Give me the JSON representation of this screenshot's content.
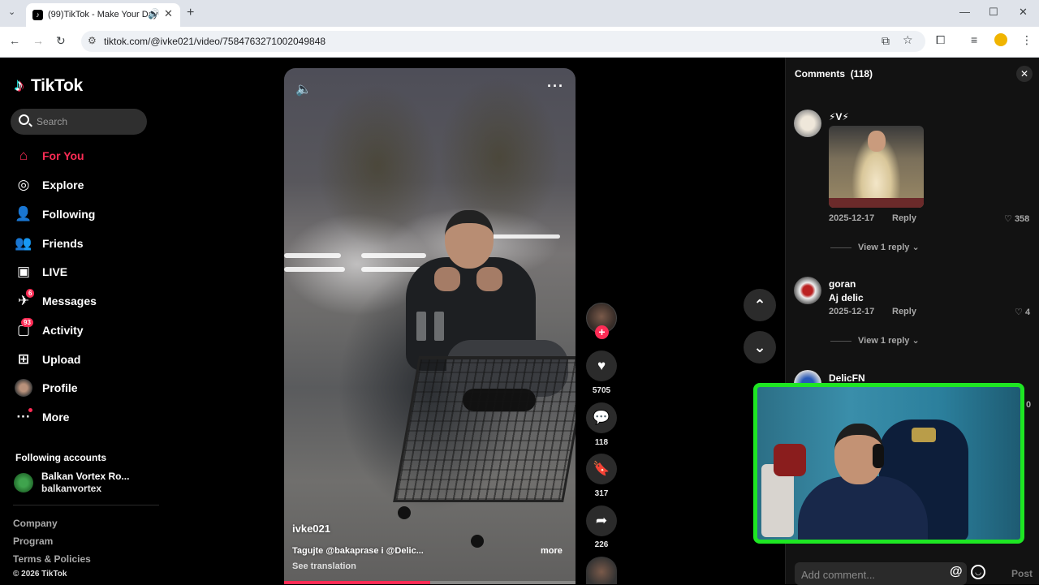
{
  "browser": {
    "tab_title": "(99)TikTok - Make Your Day",
    "url": "tiktok.com/@ivke021/video/7584763271002049848"
  },
  "sidebar": {
    "logo": "TikTok",
    "search_placeholder": "Search",
    "nav": [
      {
        "label": "For You",
        "icon": "home-icon",
        "active": true
      },
      {
        "label": "Explore",
        "icon": "compass-icon"
      },
      {
        "label": "Following",
        "icon": "following-icon"
      },
      {
        "label": "Friends",
        "icon": "friends-icon"
      },
      {
        "label": "LIVE",
        "icon": "live-icon"
      },
      {
        "label": "Messages",
        "icon": "messages-icon",
        "badge": "6"
      },
      {
        "label": "Activity",
        "icon": "activity-icon",
        "badge": "93"
      },
      {
        "label": "Upload",
        "icon": "upload-icon"
      },
      {
        "label": "Profile",
        "icon": "profile-avatar"
      },
      {
        "label": "More",
        "icon": "more-icon"
      }
    ],
    "following_accounts_title": "Following accounts",
    "following": [
      {
        "name": "Balkan Vortex Ro...",
        "handle": "balkanvortex"
      }
    ],
    "footer": [
      "Company",
      "Program",
      "Terms & Policies",
      "© 2026 TikTok"
    ]
  },
  "video": {
    "author": "ivke021",
    "description": "Tagujte @bakaprase i @Delic...",
    "more": "more",
    "see_translation": "See translation",
    "progress": 0.5
  },
  "actions": {
    "likes": "5705",
    "comments": "118",
    "saves": "317",
    "shares": "226"
  },
  "comments": {
    "title": "Comments",
    "count": "(118)",
    "items": [
      {
        "name": "⚡V⚡",
        "text": "",
        "date": "2025-12-17",
        "reply": "Reply",
        "likes": "358",
        "view_replies": "View 1 reply"
      },
      {
        "name": "goran",
        "text": "Aj delic",
        "date": "2025-12-17",
        "reply": "Reply",
        "likes": "4",
        "view_replies": "View 1 reply"
      },
      {
        "name": "DelicFN",
        "likes": "0"
      }
    ],
    "input_placeholder": "Add comment...",
    "post": "Post"
  },
  "colors": {
    "accent": "#fe2c55",
    "webcam_border": "#1ee623"
  }
}
